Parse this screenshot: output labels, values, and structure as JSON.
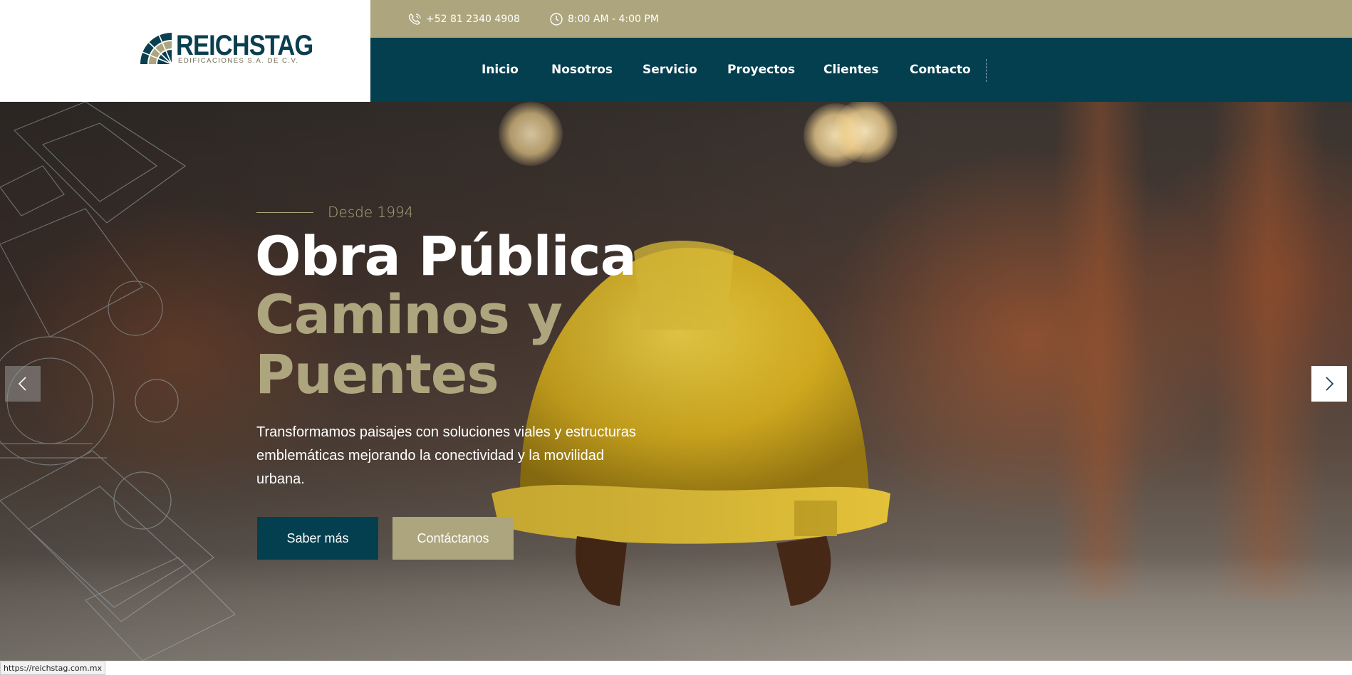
{
  "brand": {
    "name": "REICHSTAG",
    "tagline": "EDIFICACIONES S.A. DE C.V.",
    "colors": {
      "primary": "#043f50",
      "accent": "#ada57d"
    }
  },
  "topbar": {
    "phone": "+52 81 2340 4908",
    "hours": "8:00 AM - 4:00 PM",
    "phone_icon": "phone-icon",
    "hours_icon": "clock-icon"
  },
  "nav": {
    "items": [
      {
        "label": "Inicio"
      },
      {
        "label": "Nosotros"
      },
      {
        "label": "Servicio"
      },
      {
        "label": "Proyectos"
      },
      {
        "label": "Clientes"
      },
      {
        "label": "Contacto"
      }
    ]
  },
  "hero": {
    "eyebrow": "Desde 1994",
    "title_line1": "Obra Pública",
    "title_line2": "Caminos y Puentes",
    "description": "Transformamos paisajes con soluciones viales y estructuras emblemáticas mejorando la conectividad y la movilidad urbana.",
    "primary_button": "Saber más",
    "secondary_button": "Contáctanos",
    "prev_icon": "chevron-left-icon",
    "next_icon": "chevron-right-icon"
  },
  "status_bar": {
    "url": "https://reichstag.com.mx"
  }
}
